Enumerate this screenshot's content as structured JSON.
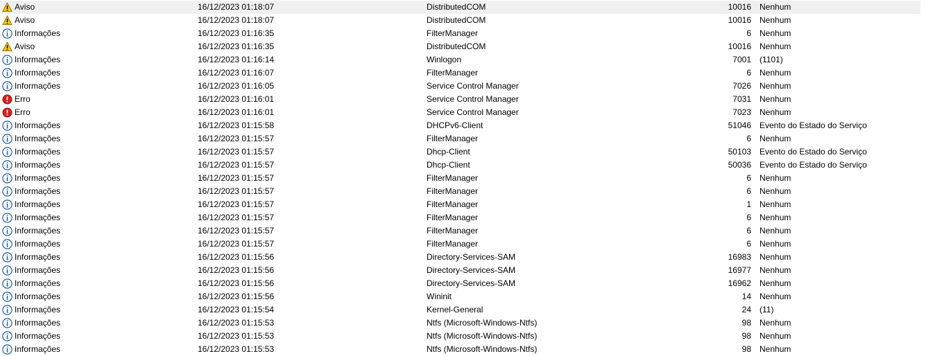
{
  "icons": {
    "Aviso": "warning-icon",
    "Informações": "information-icon",
    "Erro": "error-icon"
  },
  "colors": {
    "warning": "#f5c400",
    "information": "#1f5aa6",
    "error": "#d81e1e",
    "selected_row": "#f0f0f0"
  },
  "events": [
    {
      "level": "Aviso",
      "date": "16/12/2023 01:18:07",
      "source": "DistributedCOM",
      "id": "10016",
      "task": "Nenhum",
      "selected": true
    },
    {
      "level": "Aviso",
      "date": "16/12/2023 01:18:07",
      "source": "DistributedCOM",
      "id": "10016",
      "task": "Nenhum"
    },
    {
      "level": "Informações",
      "date": "16/12/2023 01:16:35",
      "source": "FilterManager",
      "id": "6",
      "task": "Nenhum"
    },
    {
      "level": "Aviso",
      "date": "16/12/2023 01:16:35",
      "source": "DistributedCOM",
      "id": "10016",
      "task": "Nenhum"
    },
    {
      "level": "Informações",
      "date": "16/12/2023 01:16:14",
      "source": "Winlogon",
      "id": "7001",
      "task": "(1101)"
    },
    {
      "level": "Informações",
      "date": "16/12/2023 01:16:07",
      "source": "FilterManager",
      "id": "6",
      "task": "Nenhum"
    },
    {
      "level": "Informações",
      "date": "16/12/2023 01:16:05",
      "source": "Service Control Manager",
      "id": "7026",
      "task": "Nenhum"
    },
    {
      "level": "Erro",
      "date": "16/12/2023 01:16:01",
      "source": "Service Control Manager",
      "id": "7031",
      "task": "Nenhum"
    },
    {
      "level": "Erro",
      "date": "16/12/2023 01:16:01",
      "source": "Service Control Manager",
      "id": "7023",
      "task": "Nenhum"
    },
    {
      "level": "Informações",
      "date": "16/12/2023 01:15:58",
      "source": "DHCPv6-Client",
      "id": "51046",
      "task": "Evento do Estado do Serviço"
    },
    {
      "level": "Informações",
      "date": "16/12/2023 01:15:57",
      "source": "FilterManager",
      "id": "6",
      "task": "Nenhum"
    },
    {
      "level": "Informações",
      "date": "16/12/2023 01:15:57",
      "source": "Dhcp-Client",
      "id": "50103",
      "task": "Evento do Estado do Serviço"
    },
    {
      "level": "Informações",
      "date": "16/12/2023 01:15:57",
      "source": "Dhcp-Client",
      "id": "50036",
      "task": "Evento do Estado do Serviço"
    },
    {
      "level": "Informações",
      "date": "16/12/2023 01:15:57",
      "source": "FilterManager",
      "id": "6",
      "task": "Nenhum"
    },
    {
      "level": "Informações",
      "date": "16/12/2023 01:15:57",
      "source": "FilterManager",
      "id": "6",
      "task": "Nenhum"
    },
    {
      "level": "Informações",
      "date": "16/12/2023 01:15:57",
      "source": "FilterManager",
      "id": "1",
      "task": "Nenhum"
    },
    {
      "level": "Informações",
      "date": "16/12/2023 01:15:57",
      "source": "FilterManager",
      "id": "6",
      "task": "Nenhum"
    },
    {
      "level": "Informações",
      "date": "16/12/2023 01:15:57",
      "source": "FilterManager",
      "id": "6",
      "task": "Nenhum"
    },
    {
      "level": "Informações",
      "date": "16/12/2023 01:15:57",
      "source": "FilterManager",
      "id": "6",
      "task": "Nenhum"
    },
    {
      "level": "Informações",
      "date": "16/12/2023 01:15:56",
      "source": "Directory-Services-SAM",
      "id": "16983",
      "task": "Nenhum"
    },
    {
      "level": "Informações",
      "date": "16/12/2023 01:15:56",
      "source": "Directory-Services-SAM",
      "id": "16977",
      "task": "Nenhum"
    },
    {
      "level": "Informações",
      "date": "16/12/2023 01:15:56",
      "source": "Directory-Services-SAM",
      "id": "16962",
      "task": "Nenhum"
    },
    {
      "level": "Informações",
      "date": "16/12/2023 01:15:56",
      "source": "Wininit",
      "id": "14",
      "task": "Nenhum"
    },
    {
      "level": "Informações",
      "date": "16/12/2023 01:15:54",
      "source": "Kernel-General",
      "id": "24",
      "task": "(11)"
    },
    {
      "level": "Informações",
      "date": "16/12/2023 01:15:53",
      "source": "Ntfs (Microsoft-Windows-Ntfs)",
      "id": "98",
      "task": "Nenhum"
    },
    {
      "level": "Informações",
      "date": "16/12/2023 01:15:53",
      "source": "Ntfs (Microsoft-Windows-Ntfs)",
      "id": "98",
      "task": "Nenhum"
    },
    {
      "level": "Informações",
      "date": "16/12/2023 01:15:53",
      "source": "Ntfs (Microsoft-Windows-Ntfs)",
      "id": "98",
      "task": "Nenhum"
    }
  ]
}
